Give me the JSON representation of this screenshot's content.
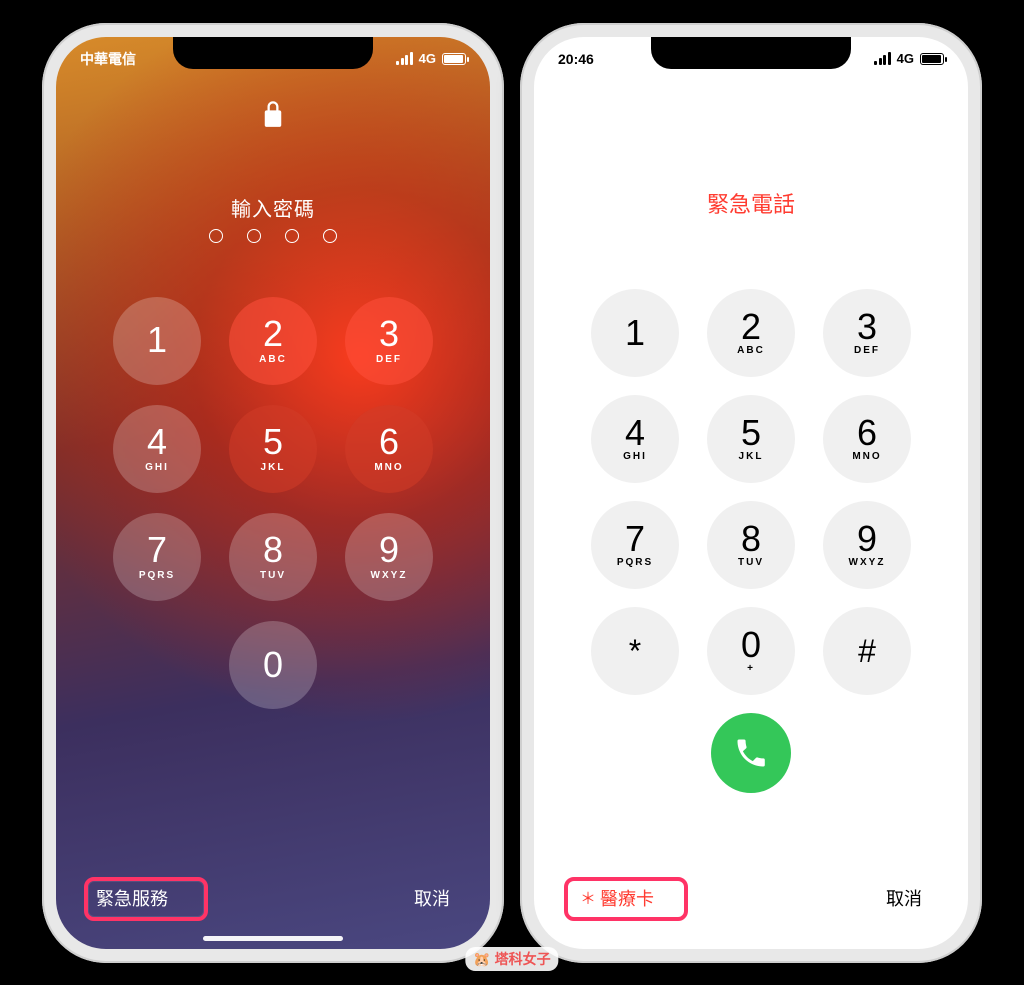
{
  "left": {
    "status": {
      "carrier": "中華電信",
      "network": "4G"
    },
    "prompt": "輸入密碼",
    "keys": [
      {
        "n": "1",
        "l": ""
      },
      {
        "n": "2",
        "l": "ABC"
      },
      {
        "n": "3",
        "l": "DEF"
      },
      {
        "n": "4",
        "l": "GHI"
      },
      {
        "n": "5",
        "l": "JKL"
      },
      {
        "n": "6",
        "l": "MNO"
      },
      {
        "n": "7",
        "l": "PQRS"
      },
      {
        "n": "8",
        "l": "TUV"
      },
      {
        "n": "9",
        "l": "WXYZ"
      },
      {
        "n": "0",
        "l": ""
      }
    ],
    "emergency": "緊急服務",
    "cancel": "取消"
  },
  "right": {
    "status": {
      "time": "20:46",
      "network": "4G"
    },
    "title": "緊急電話",
    "keys": [
      {
        "n": "1",
        "l": ""
      },
      {
        "n": "2",
        "l": "ABC"
      },
      {
        "n": "3",
        "l": "DEF"
      },
      {
        "n": "4",
        "l": "GHI"
      },
      {
        "n": "5",
        "l": "JKL"
      },
      {
        "n": "6",
        "l": "MNO"
      },
      {
        "n": "7",
        "l": "PQRS"
      },
      {
        "n": "8",
        "l": "TUV"
      },
      {
        "n": "9",
        "l": "WXYZ"
      },
      {
        "n": "*",
        "l": ""
      },
      {
        "n": "0",
        "l": "+"
      },
      {
        "n": "#",
        "l": ""
      }
    ],
    "medical_prefix": "＊",
    "medical": "醫療卡",
    "cancel": "取消"
  },
  "watermark": "塔科女子"
}
